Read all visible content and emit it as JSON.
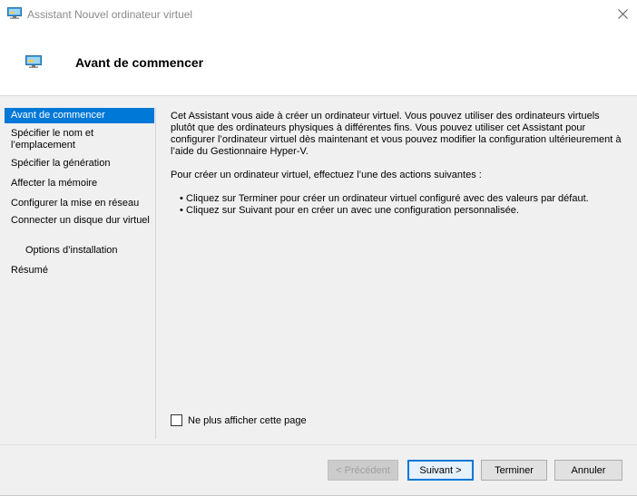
{
  "window": {
    "title": "Assistant Nouvel ordinateur virtuel"
  },
  "header": {
    "title": "Avant de commencer"
  },
  "nav": {
    "items": [
      {
        "label": "Avant de commencer",
        "selected": true
      },
      {
        "label": "Spécifier le nom et l’emplacement"
      },
      {
        "label": "Spécifier la génération"
      },
      {
        "label": "Affecter la mémoire"
      },
      {
        "label": "Configurer la mise en réseau"
      },
      {
        "label": "Connecter un disque dur virtuel"
      },
      {
        "label": "Options d’installation"
      },
      {
        "label": "Résumé"
      }
    ]
  },
  "content": {
    "intro": "Cet Assistant vous aide à créer un ordinateur virtuel. Vous pouvez utiliser des ordinateurs virtuels plutôt que des ordinateurs physiques à différentes fins. Vous pouvez utiliser cet Assistant pour configurer l’ordinateur virtuel dès maintenant et vous pouvez modifier la configuration ultérieurement à l’aide du Gestionnaire Hyper-V.",
    "instruction": "Pour créer un ordinateur virtuel, effectuez l’une des actions suivantes :",
    "bullets": [
      "Cliquez sur Terminer pour créer un ordinateur virtuel configuré avec des valeurs par défaut.",
      "Cliquez sur Suivant pour en créer un avec une configuration personnalisée."
    ]
  },
  "checkbox": {
    "label": "Ne plus afficher cette page",
    "checked": false
  },
  "footer": {
    "previous": "< Précédent",
    "next": "Suivant >",
    "finish": "Terminer",
    "cancel": "Annuler"
  },
  "colors": {
    "accent": "#0078d7",
    "panel": "#f0f0f0"
  }
}
